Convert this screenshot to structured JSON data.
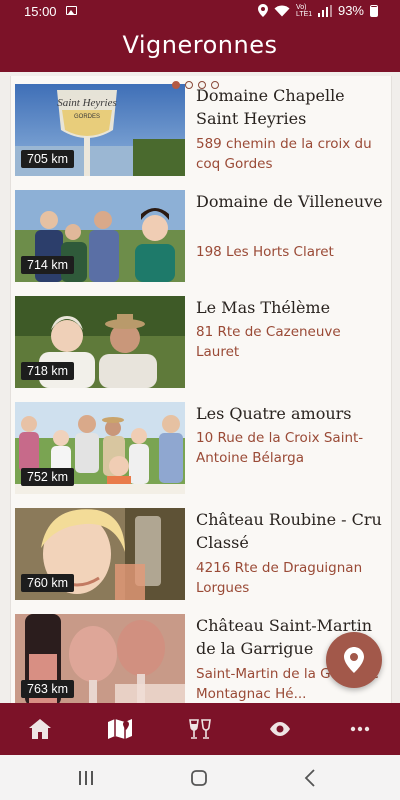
{
  "status_bar": {
    "time": "15:00",
    "network": "Vo) LTE1",
    "battery": "93%"
  },
  "app_bar": {
    "title": "Vigneronnes"
  },
  "carousel": {
    "total": 4,
    "active": 1
  },
  "domains": [
    {
      "name": "Domaine Chapelle Saint Heyries",
      "address": "589 chemin de la croix du coq Gordes",
      "distance": "705 km",
      "thumb_text": "Saint Heyries",
      "thumb_sub": "GORDES"
    },
    {
      "name": "Domaine de Villeneuve",
      "address": "198 Les Horts Claret",
      "distance": "714 km"
    },
    {
      "name": "Le Mas Thélème",
      "address": "81 Rte de Cazeneuve Lauret",
      "distance": "718 km"
    },
    {
      "name": "Les Quatre amours",
      "address": "10 Rue de la Croix Saint-Antoine Bélarga",
      "distance": "752 km"
    },
    {
      "name": "Château Roubine - Cru Classé",
      "address": "4216 Rte de Draguignan Lorgues",
      "distance": "760 km"
    },
    {
      "name": "Château Saint-Martin de la Garrigue",
      "address": "Saint-Martin de la Garrigue Montagnac Hé...",
      "distance": "763 km"
    }
  ],
  "bottom_nav": {
    "items": [
      {
        "icon": "home-icon"
      },
      {
        "icon": "map-icon"
      },
      {
        "icon": "wine-glasses-icon"
      },
      {
        "icon": "eye-icon"
      },
      {
        "icon": "more-icon"
      }
    ]
  },
  "colors": {
    "primary": "#7c1228",
    "accent_text": "#9a4a36",
    "fab": "#a2584a"
  }
}
